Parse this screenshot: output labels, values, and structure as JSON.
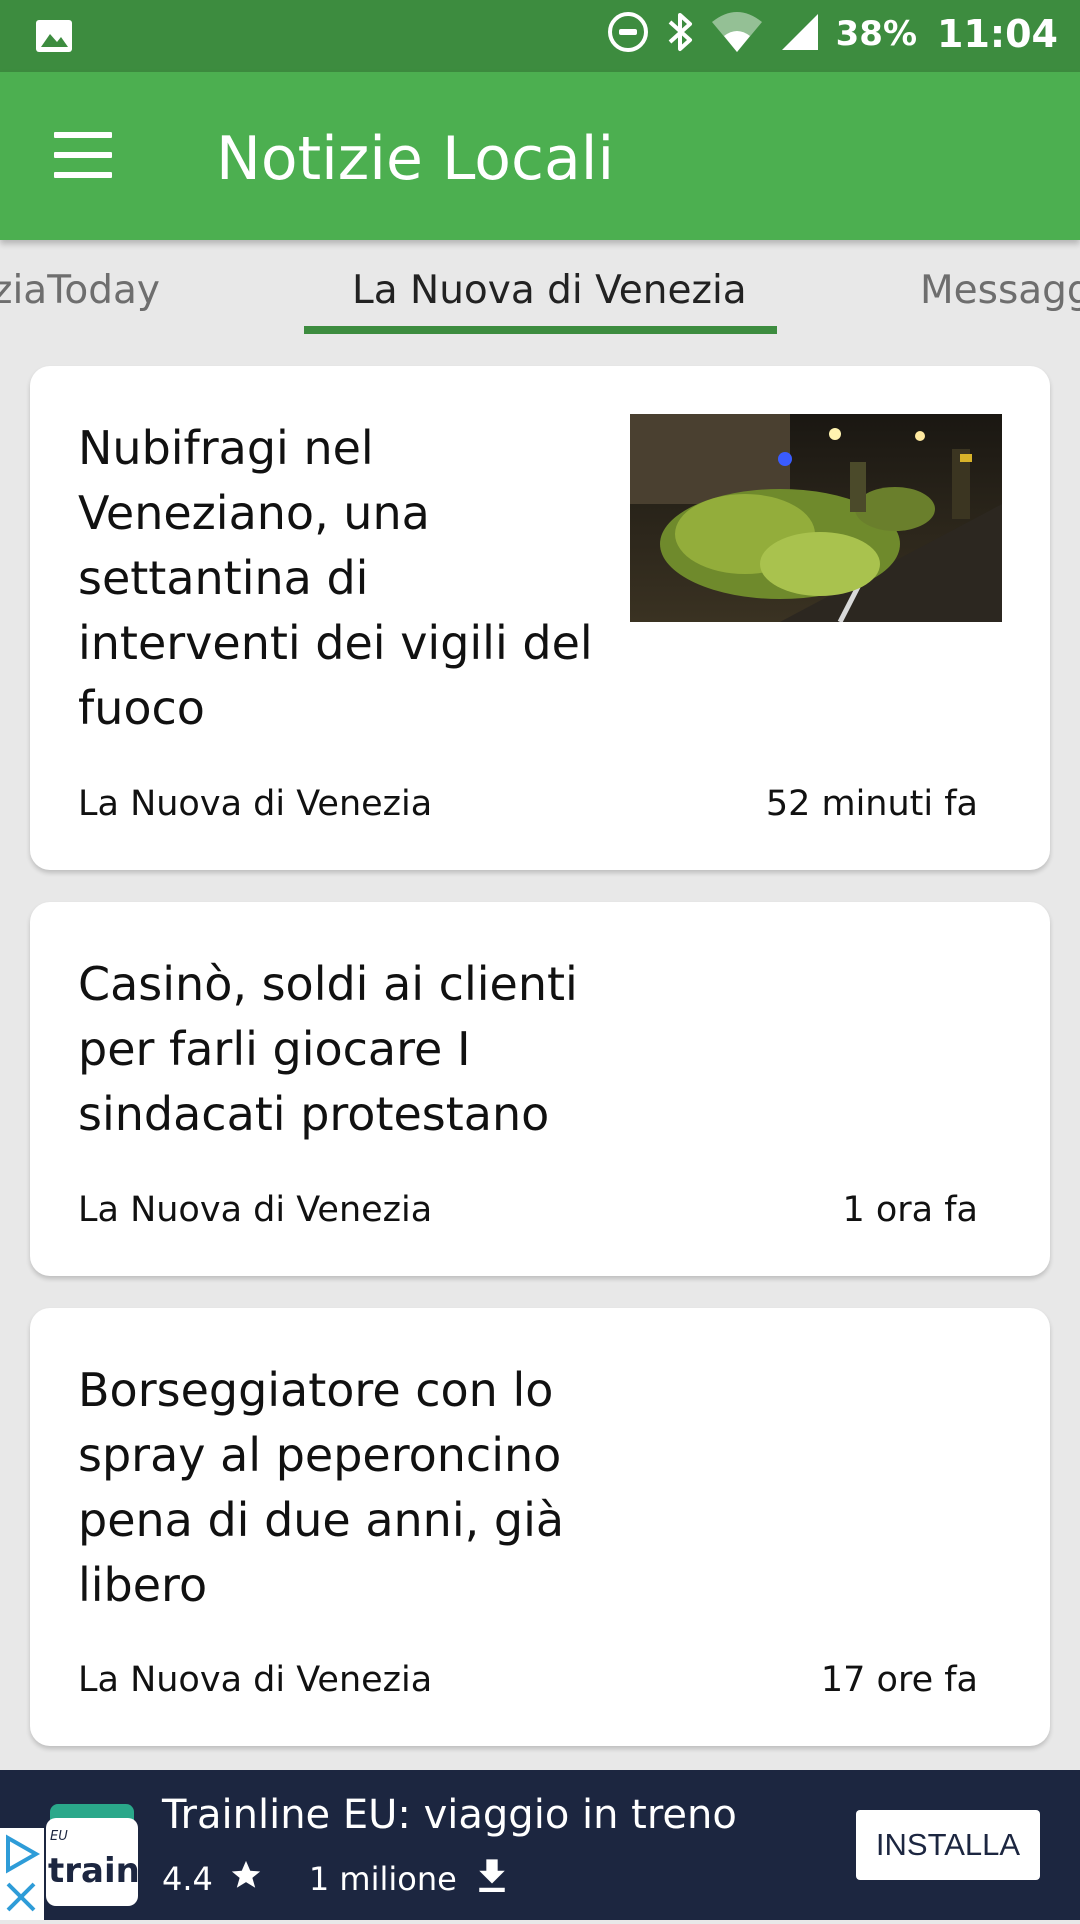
{
  "status_bar": {
    "battery": "38%",
    "time": "11:04",
    "icons": [
      "image-icon",
      "do-not-disturb-icon",
      "bluetooth-icon",
      "wifi-icon",
      "cell-signal-icon"
    ]
  },
  "app_bar": {
    "title": "Notizie Locali",
    "menu_icon": "hamburger-menu-icon",
    "color": "#4caf50"
  },
  "tabs": [
    {
      "label": "ziaToday",
      "active": false
    },
    {
      "label": "La Nuova di Venezia",
      "active": true
    },
    {
      "label": "Messagg",
      "active": false
    }
  ],
  "articles": [
    {
      "headline": "Nubifragi nel Veneziano, una settantina di interventi dei vigili del fuoco",
      "source": "La Nuova di Venezia",
      "time": "52 minuti fa",
      "has_image": true
    },
    {
      "headline": "Casinò, soldi ai clienti per farli giocare I sindacati protestano",
      "source": "La Nuova di Venezia",
      "time": "1 ora fa",
      "has_image": false
    },
    {
      "headline": "Borseggiatore con lo spray al peperoncino pena di due anni, già libero",
      "source": "La Nuova di Venezia",
      "time": "17 ore fa",
      "has_image": false
    }
  ],
  "ad": {
    "title": "Trainline EU: viaggio in treno",
    "rating": "4.4",
    "downloads": "1 milione",
    "button": "INSTALLA",
    "logo_small": "EU",
    "logo_text": "train"
  }
}
